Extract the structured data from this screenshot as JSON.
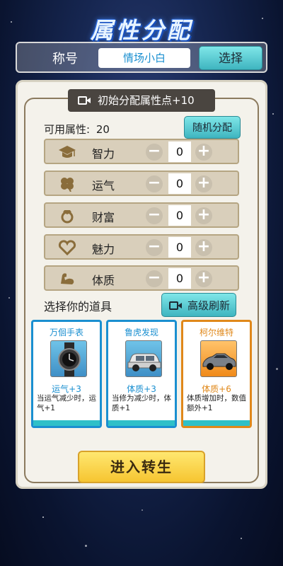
{
  "page_title": "属性分配",
  "title_row": {
    "label": "称号",
    "value": "情场小白",
    "select_label": "选择"
  },
  "bonus_button": {
    "label": "初始分配属性点+10"
  },
  "available": {
    "label": "可用属性:",
    "value": "20"
  },
  "random_button": {
    "label": "随机分配"
  },
  "attributes": [
    {
      "name": "智力",
      "value": "0",
      "icon": "graduation-cap-icon"
    },
    {
      "name": "运气",
      "value": "0",
      "icon": "clover-icon"
    },
    {
      "name": "财富",
      "value": "0",
      "icon": "ring-icon"
    },
    {
      "name": "魅力",
      "value": "0",
      "icon": "heart-icon"
    },
    {
      "name": "体质",
      "value": "0",
      "icon": "muscle-icon"
    }
  ],
  "stepper": {
    "minus": "−",
    "plus": "+"
  },
  "items_section": {
    "label": "选择你的道具",
    "refresh_label": "高级刷新"
  },
  "items": [
    {
      "name": "万佪手表",
      "effect": "运气+3",
      "desc": "当运气减少时，运气+1",
      "color": "#1a8fd0",
      "icon": "watch-icon"
    },
    {
      "name": "鲁虎发现",
      "effect": "体质+3",
      "desc": "当修为减少时，体质+1",
      "color": "#1a8fd0",
      "icon": "suv-icon"
    },
    {
      "name": "柯尔维特",
      "effect": "体质+6",
      "desc": "体质增加时，数值额外+1",
      "color": "#e0881a",
      "icon": "sports-car-icon"
    }
  ],
  "enter_button": {
    "label": "进入转生"
  },
  "colors": {
    "accent_cyan": "#3fb5c0",
    "gold": "#f6c531",
    "panel": "#f4f2eb"
  }
}
